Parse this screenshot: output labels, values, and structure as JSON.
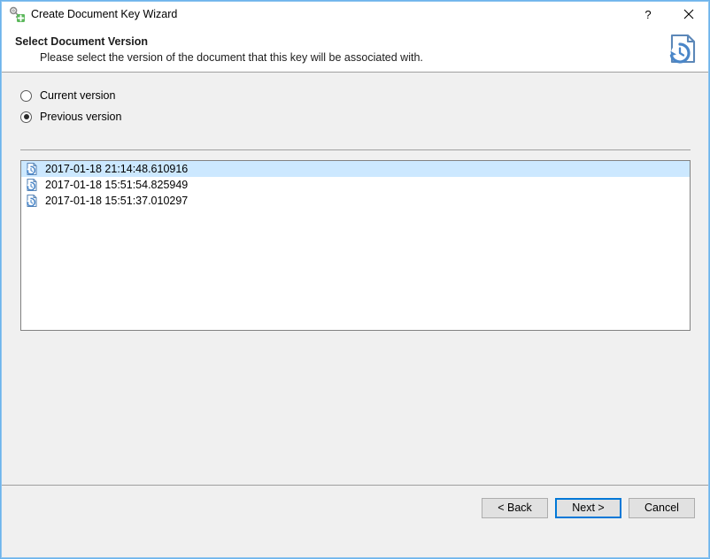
{
  "window": {
    "title": "Create Document Key Wizard",
    "title_icon": "key-add-icon",
    "border_color": "#8cc4ef",
    "controls": [
      {
        "name": "help-button",
        "glyph": "?"
      },
      {
        "name": "close-button",
        "glyph": "✕"
      }
    ]
  },
  "header": {
    "title": "Select Document Version",
    "subtitle": "Please select the version of the document that this key will be associated with.",
    "banner_icon": "document-version-history-icon"
  },
  "options": {
    "radios": [
      {
        "label": "Current version",
        "checked": false,
        "name": "radio-current-version"
      },
      {
        "label": "Previous version",
        "checked": true,
        "name": "radio-previous-version"
      }
    ]
  },
  "version_list": {
    "icon": "document-version-icon",
    "selection_color": "#cce8ff",
    "items": [
      {
        "label": "2017-01-18 21:14:48.610916",
        "selected": true
      },
      {
        "label": "2017-01-18 15:51:54.825949",
        "selected": false
      },
      {
        "label": "2017-01-18 15:51:37.010297",
        "selected": false
      }
    ]
  },
  "footer": {
    "buttons": [
      {
        "label": "< Back",
        "name": "back-button",
        "default": false
      },
      {
        "label": "Next >",
        "name": "next-button",
        "default": true
      },
      {
        "label": "Cancel",
        "name": "cancel-button",
        "default": false
      }
    ],
    "accent_color": "#0078d7"
  }
}
